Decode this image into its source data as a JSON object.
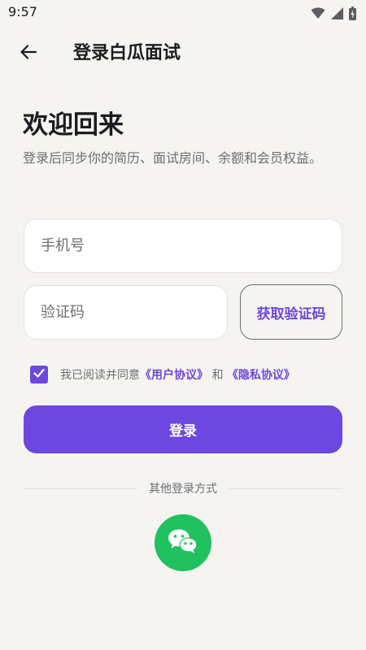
{
  "status_bar": {
    "time": "9:57",
    "icons": [
      "wifi-icon",
      "signal-icon",
      "battery-charging-icon"
    ]
  },
  "header": {
    "back_icon": "arrow-left-icon",
    "title": "登录白瓜面试"
  },
  "welcome": {
    "title": "欢迎回来",
    "subtitle": "登录后同步你的简历、面试房间、余额和会员权益。"
  },
  "form": {
    "phone_placeholder": "手机号",
    "phone_value": "",
    "code_placeholder": "验证码",
    "code_value": "",
    "send_code_label": "获取验证码"
  },
  "agreement": {
    "checked": true,
    "prefix": "我已阅读并同意",
    "user_agreement": "《用户协议》",
    "connector": "和",
    "privacy_policy": "《隐私协议》"
  },
  "login_button": {
    "label": "登录"
  },
  "other_login": {
    "label": "其他登录方式",
    "wechat_icon": "wechat-icon"
  },
  "colors": {
    "background": "#f5f4f1",
    "accent": "#6c47e0",
    "wechat_green": "#20c15e",
    "text_primary": "#1c1b1f",
    "text_secondary": "#6f6d72"
  }
}
